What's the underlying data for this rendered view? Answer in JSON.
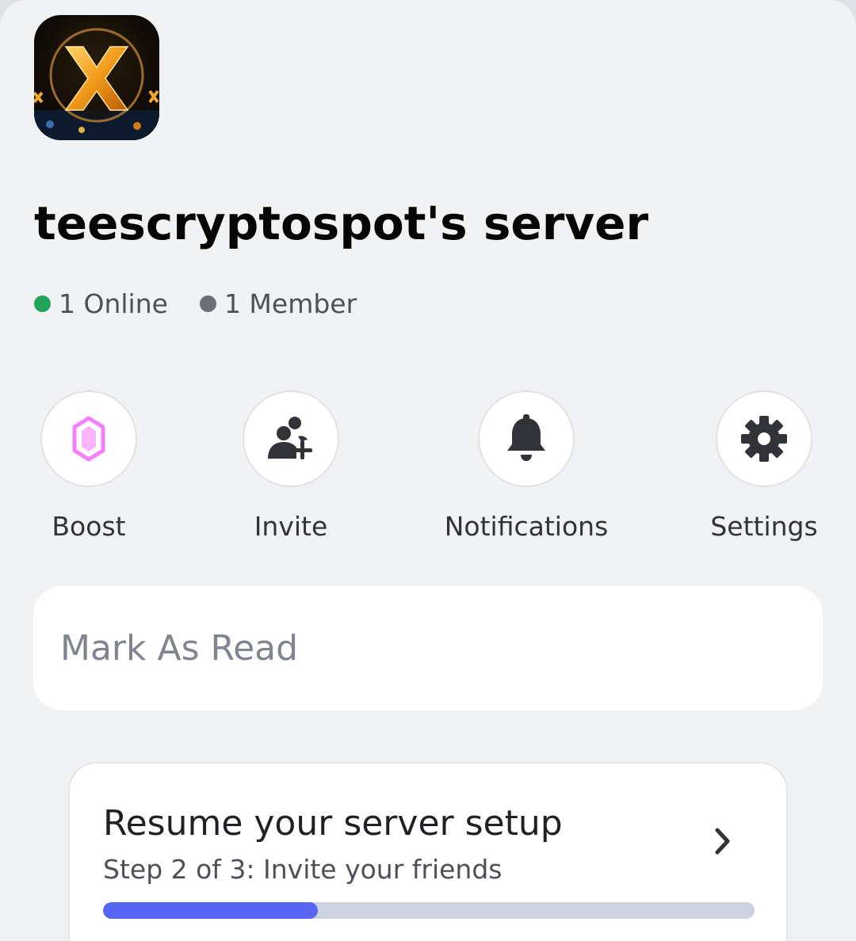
{
  "server": {
    "name": "teescryptospot's server",
    "icon": "xrp-server-icon"
  },
  "stats": {
    "online_label": "1 Online",
    "members_label": "1 Member"
  },
  "actions": {
    "boost": {
      "label": "Boost",
      "icon": "boost-gem-icon"
    },
    "invite": {
      "label": "Invite",
      "icon": "add-user-icon"
    },
    "notifications": {
      "label": "Notifications",
      "icon": "bell-icon"
    },
    "settings": {
      "label": "Settings",
      "icon": "gear-icon"
    }
  },
  "mark_read": {
    "label": "Mark As Read"
  },
  "setup": {
    "title": "Resume your server setup",
    "subtitle": "Step 2 of 3: Invite your friends",
    "progress": 0.33
  },
  "colors": {
    "online": "#23a559",
    "member": "#6d6f78",
    "boost": "#f47fff",
    "accent": "#5865f2"
  }
}
